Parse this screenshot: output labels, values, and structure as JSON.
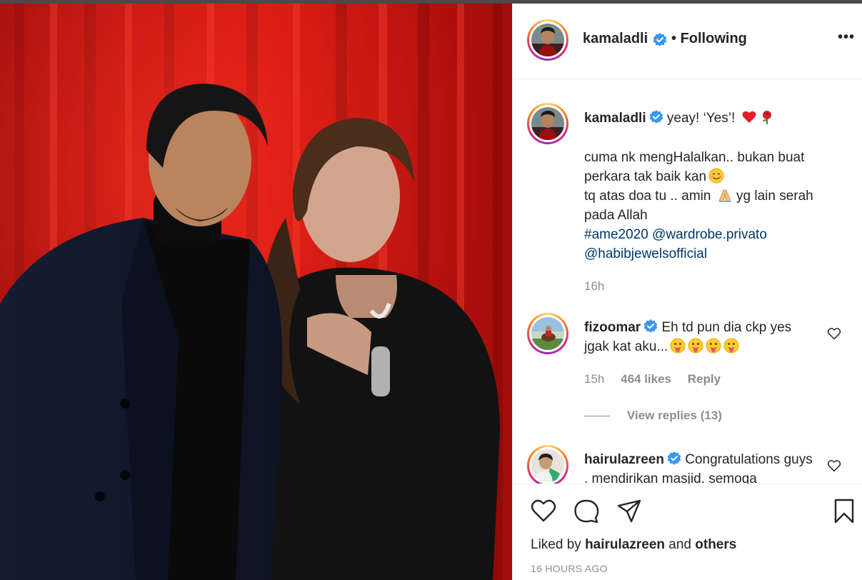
{
  "post": {
    "author": {
      "username": "kamaladli",
      "verified": true,
      "follow_status": "Following"
    },
    "caption": {
      "first_line": "yeay! ‘Yes’!",
      "lines": [
        "cuma nk mengHalalkan.. bukan buat perkara tak baik kan",
        "tq atas doa tu .. amin",
        "yg lain serah pada Allah"
      ],
      "hashtag": "#ame2020",
      "mention_1": "@wardrobe.privato",
      "mention_2": "@habibjewelsofficial",
      "time": "16h"
    },
    "comments": [
      {
        "username": "fizoomar",
        "verified": true,
        "text": "Eh td pun dia ckp yes jgak kat aku...",
        "time": "15h",
        "likes": "464 likes",
        "reply_label": "Reply",
        "view_replies": "View replies (13)"
      },
      {
        "username": "hairulazreen",
        "verified": true,
        "text": "Congratulations guys . mendirikan masjid. semoga"
      }
    ],
    "liked_by": {
      "prefix": "Liked by",
      "user": "hairulazreen",
      "joiner": "and",
      "others": "others"
    },
    "posted_ago": "16 HOURS AGO"
  },
  "icons": {
    "like": "heart-icon",
    "comment": "comment-bubble-icon",
    "share": "paper-plane-icon",
    "save": "bookmark-icon",
    "more": "more-options-icon",
    "verified": "verified-badge-icon"
  },
  "colors": {
    "accent_link": "#00376b",
    "muted": "#8e8e8e",
    "verified_blue": "#3897f0",
    "text": "#262626"
  }
}
